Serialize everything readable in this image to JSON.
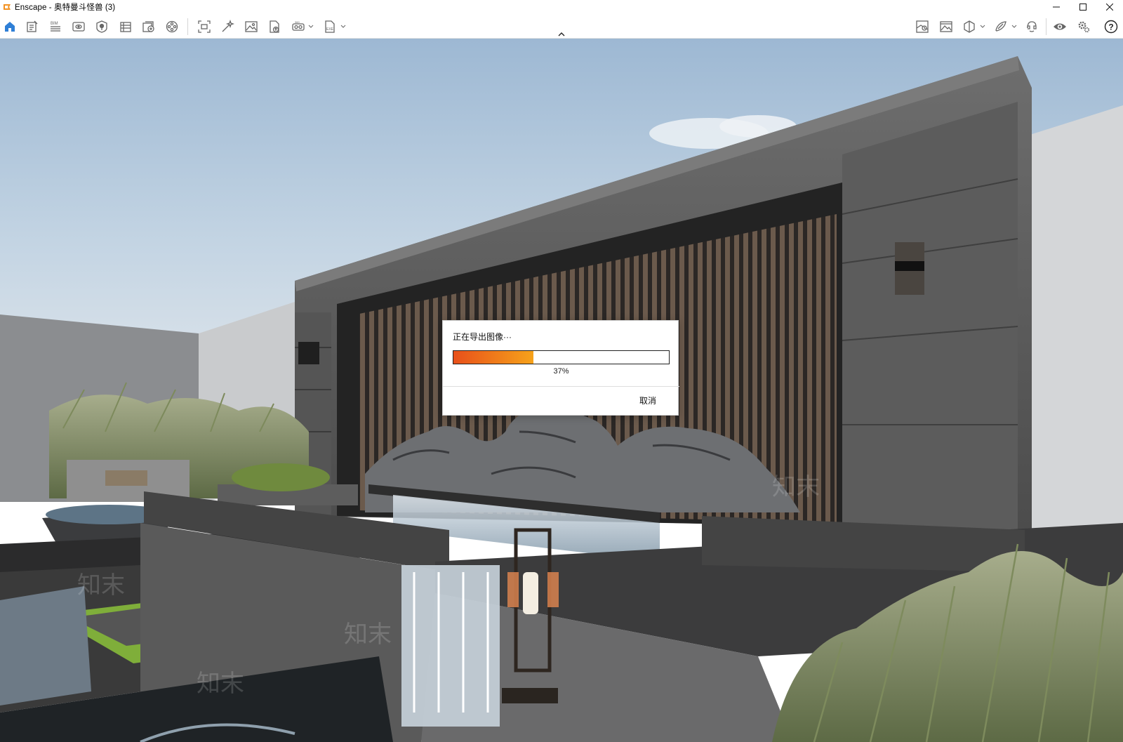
{
  "window": {
    "title": "Enscape - 奥特曼斗怪兽 (3)",
    "controls": [
      "minimize-icon",
      "maximize-icon",
      "close-icon"
    ]
  },
  "toolbar": {
    "left_icons": [
      "home-icon",
      "notes-icon",
      "bim-icon",
      "views-icon",
      "asset-library-icon",
      "building-icon",
      "batch-render-icon",
      "video-icon",
      "screenshot-icon",
      "magic-wand-icon",
      "image-icon",
      "upload-icon",
      "vr-headset-icon",
      "exe-export-icon"
    ],
    "right_icons": [
      "mini-map-icon",
      "picture-icon",
      "section-box-icon",
      "light-icon",
      "collaboration-icon",
      "visual-settings-icon",
      "settings-icon",
      "help-icon"
    ],
    "accent_color": "#2f7fd6"
  },
  "dialog": {
    "title": "正在导出图像···",
    "progress": 0.37,
    "progress_label": "37%",
    "cancel_label": "取消",
    "progress_colors": [
      "#e8501a",
      "#f6a21a"
    ]
  },
  "watermark": {
    "text": "知末"
  }
}
